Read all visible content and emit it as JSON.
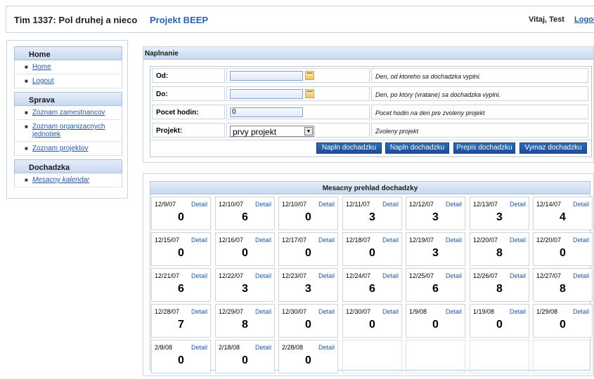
{
  "header": {
    "team": "Tim 1337: Pol druhej a nieco",
    "project": "Projekt BEEP",
    "welcome": "Vitaj, Test",
    "logout": "Logout"
  },
  "sidebar": {
    "sections": [
      {
        "title": "Home",
        "items": [
          {
            "label": "Home"
          },
          {
            "label": "Logout"
          }
        ]
      },
      {
        "title": "Sprava",
        "items": [
          {
            "label": "Zoznam zamestnancov"
          },
          {
            "label": "Zoznam organizacnych jednotiek"
          },
          {
            "label": "Zoznam projektov"
          }
        ]
      },
      {
        "title": "Dochadzka",
        "items": [
          {
            "label": "Mesacny kalendar"
          }
        ]
      }
    ]
  },
  "form": {
    "title": "Naplnanie",
    "rows": [
      {
        "label": "Od:",
        "value": "",
        "desc": "Den, od ktoreho sa dochadzka vyplni."
      },
      {
        "label": "Do:",
        "value": "",
        "desc": "Den, po ktory (vratane) sa dochadzka vyplni."
      },
      {
        "label": "Pocet hodin:",
        "value": "0",
        "desc": "Pocet hodin na den pre zvoleny projekt"
      },
      {
        "label": "Projekt:",
        "value": "prvy projekt",
        "desc": "Zvoleny projekt"
      }
    ],
    "buttons": [
      "Napln dochadzku",
      "Napln dochadzku",
      "Prepis dochadzku",
      "Vymaz dochadzku"
    ]
  },
  "calendar": {
    "title": "Mesacny prehlad dochadzky",
    "detail_label": "Detail",
    "days": [
      {
        "date": "12/9/07",
        "hours": "0"
      },
      {
        "date": "12/10/07",
        "hours": "6"
      },
      {
        "date": "12/10/07",
        "hours": "0"
      },
      {
        "date": "12/11/07",
        "hours": "3"
      },
      {
        "date": "12/12/07",
        "hours": "3"
      },
      {
        "date": "12/13/07",
        "hours": "3"
      },
      {
        "date": "12/14/07",
        "hours": "4"
      },
      {
        "date": "12/15/07",
        "hours": "0"
      },
      {
        "date": "12/16/07",
        "hours": "0"
      },
      {
        "date": "12/17/07",
        "hours": "0"
      },
      {
        "date": "12/18/07",
        "hours": "0"
      },
      {
        "date": "12/19/07",
        "hours": "3"
      },
      {
        "date": "12/20/07",
        "hours": "8"
      },
      {
        "date": "12/20/07",
        "hours": "0"
      },
      {
        "date": "12/21/07",
        "hours": "6"
      },
      {
        "date": "12/22/07",
        "hours": "3"
      },
      {
        "date": "12/23/07",
        "hours": "3"
      },
      {
        "date": "12/24/07",
        "hours": "6"
      },
      {
        "date": "12/25/07",
        "hours": "6"
      },
      {
        "date": "12/26/07",
        "hours": "8"
      },
      {
        "date": "12/27/07",
        "hours": "8"
      },
      {
        "date": "12/28/07",
        "hours": "7"
      },
      {
        "date": "12/29/07",
        "hours": "8"
      },
      {
        "date": "12/30/07",
        "hours": "0"
      },
      {
        "date": "12/30/07",
        "hours": "0"
      },
      {
        "date": "1/9/08",
        "hours": "0"
      },
      {
        "date": "1/19/08",
        "hours": "0"
      },
      {
        "date": "1/29/08",
        "hours": "0"
      },
      {
        "date": "2/8/08",
        "hours": "0"
      },
      {
        "date": "2/18/08",
        "hours": "0"
      },
      {
        "date": "2/28/08",
        "hours": "0"
      }
    ]
  }
}
